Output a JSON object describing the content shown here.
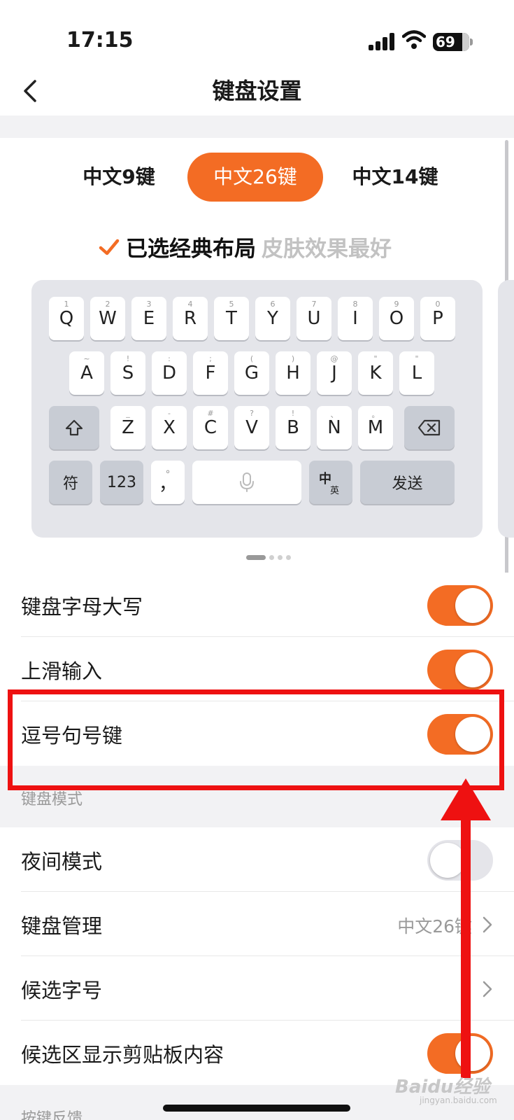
{
  "status_bar": {
    "time": "17:15",
    "battery": "69"
  },
  "nav": {
    "title": "键盘设置"
  },
  "tabs": [
    {
      "label": "中文9键",
      "active": false
    },
    {
      "label": "中文26键",
      "active": true
    },
    {
      "label": "中文14键",
      "active": false
    }
  ],
  "layout_hint": {
    "selected": "已选经典布局",
    "note": "皮肤效果最好"
  },
  "keyboard": {
    "row1": [
      {
        "k": "Q",
        "n": "1"
      },
      {
        "k": "W",
        "n": "2"
      },
      {
        "k": "E",
        "n": "3"
      },
      {
        "k": "R",
        "n": "4"
      },
      {
        "k": "T",
        "n": "5"
      },
      {
        "k": "Y",
        "n": "6"
      },
      {
        "k": "U",
        "n": "7"
      },
      {
        "k": "I",
        "n": "8"
      },
      {
        "k": "O",
        "n": "9"
      },
      {
        "k": "P",
        "n": "0"
      }
    ],
    "row2": [
      {
        "k": "A",
        "n": "~"
      },
      {
        "k": "S",
        "n": "!"
      },
      {
        "k": "D",
        "n": ":"
      },
      {
        "k": "F",
        "n": ";"
      },
      {
        "k": "G",
        "n": "("
      },
      {
        "k": "H",
        "n": ")"
      },
      {
        "k": "J",
        "n": "@"
      },
      {
        "k": "K",
        "n": "\""
      },
      {
        "k": "L",
        "n": "\""
      }
    ],
    "row3": [
      {
        "k": "Z",
        "n": "_"
      },
      {
        "k": "X",
        "n": "-"
      },
      {
        "k": "C",
        "n": "#"
      },
      {
        "k": "V",
        "n": "?"
      },
      {
        "k": "B",
        "n": "!"
      },
      {
        "k": "N",
        "n": "、"
      },
      {
        "k": "M",
        "n": "。"
      }
    ],
    "symbol_key": "符",
    "number_key": "123",
    "comma_key": "，",
    "period_small": "°",
    "lang_key_main": "中",
    "lang_key_sub": "英",
    "send_key": "发送"
  },
  "settings": {
    "caps": {
      "label": "键盘字母大写",
      "on": true
    },
    "swipe": {
      "label": "上滑输入",
      "on": true
    },
    "comma_period": {
      "label": "逗号句号键",
      "on": true
    },
    "section_mode": "键盘模式",
    "night_mode": {
      "label": "夜间模式",
      "on": false
    },
    "keyboard_manage": {
      "label": "键盘管理",
      "value": "中文26键"
    },
    "candidate_font": {
      "label": "候选字号"
    },
    "clipboard": {
      "label": "候选区显示剪贴板内容",
      "on": true
    },
    "section_feedback": "按键反馈"
  },
  "watermark": {
    "main": "Baidu经验",
    "sub": "jingyan.baidu.com"
  },
  "colors": {
    "accent": "#f36c24",
    "annotation": "#ee1111",
    "section_bg": "#f2f2f4"
  }
}
